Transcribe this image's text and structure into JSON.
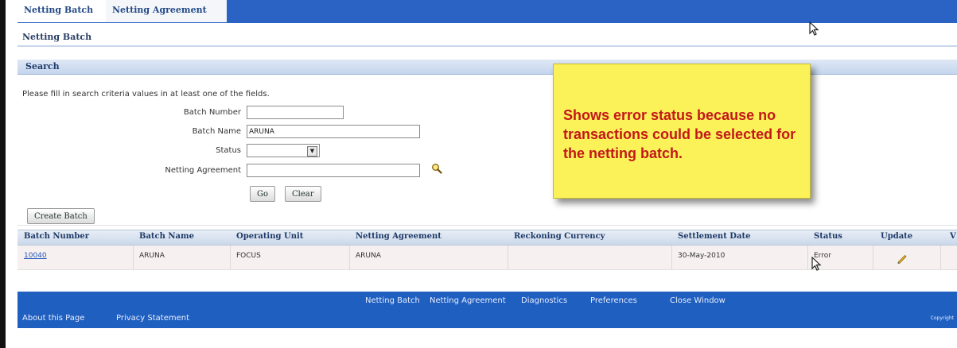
{
  "tabs": [
    "Netting Batch",
    "Netting Agreement"
  ],
  "page_title": "Netting Batch",
  "search": {
    "title": "Search",
    "instruction": "Please fill in search criteria values in at least one of the fields.",
    "fields": {
      "batch_number": {
        "label": "Batch Number",
        "value": ""
      },
      "batch_name": {
        "label": "Batch Name",
        "value": "ARUNA"
      },
      "status": {
        "label": "Status",
        "value": ""
      },
      "netting_agreement": {
        "label": "Netting Agreement",
        "value": ""
      }
    },
    "go_label": "Go",
    "clear_label": "Clear"
  },
  "callout": {
    "text": "Shows error status because no transactions could be selected for the netting batch.",
    "bg_color": "#fbf25a",
    "text_color": "#c31818"
  },
  "create_batch_label": "Create Batch",
  "table": {
    "headers": [
      "Batch Number",
      "Batch Name",
      "Operating Unit",
      "Netting Agreement",
      "Reckoning Currency",
      "Settlement Date",
      "Status",
      "Update",
      "V"
    ],
    "rows": [
      {
        "batch_number": "10040",
        "batch_name": "ARUNA",
        "operating_unit": "FOCUS",
        "netting_agreement": "ARUNA",
        "reckoning_currency": "",
        "settlement_date": "30-May-2010",
        "status": "Error",
        "update_icon": "pencil-icon"
      }
    ]
  },
  "footer": {
    "links": [
      "Netting Batch",
      "Netting Agreement",
      "Diagnostics",
      "Preferences",
      "Close Window"
    ],
    "about": "About this Page",
    "privacy": "Privacy Statement",
    "copyright": "Copyright"
  },
  "colors": {
    "tab_blue": "#2a63c4",
    "footer_blue": "#1f5fbf",
    "header_gradient": "#cbd8ea"
  }
}
